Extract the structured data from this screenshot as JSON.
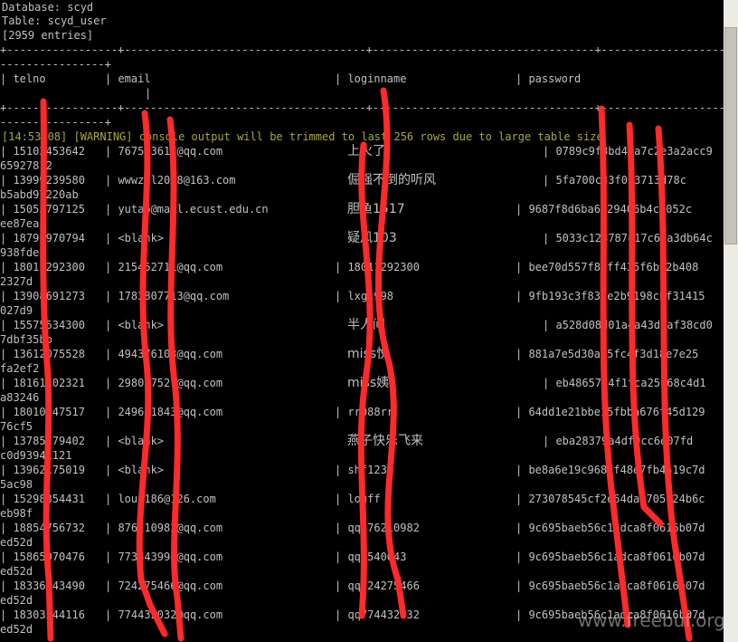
{
  "header": {
    "database": "Database: scyd",
    "table": "Table: scyd_user",
    "entries": "[2959 entries]"
  },
  "borders": {
    "top": "+-----------------+-------------------------------------+----------------------------------+-------------------------------------",
    "cont": "----------------+",
    "mid": "+-----------------+-------------------------------------+----------------------------------+-------------------------------------"
  },
  "columns": {
    "telno": "| telno",
    "email": "| email",
    "loginname": "| loginname",
    "password": "| password",
    "cont": "|"
  },
  "warning": "[14:53:08] [WARNING] console output will be trimmed to last 256 rows due to large table size",
  "rows": [
    {
      "telno": "| 15102453642",
      "email": "| 767523617@qq.com",
      "login": "上火了",
      "pass": "| 0789c9f8bd4da7c2e3a2acc9",
      "cont": "65927812"
    },
    {
      "telno": "| 13999239580",
      "email": "| wwwzhl2008@163.com",
      "login": "倔强不倒的听风",
      "pass": "| 5fa700c33f013713d78c",
      "cont": "b5abd97220ab"
    },
    {
      "telno": "| 15055797125",
      "email": "| yutao@mail.ecust.edu.cn",
      "login": "胆鱼1517",
      "pass": "| 9687f8d6ba6729406b4c1052c",
      "cont": "ee87ea"
    },
    {
      "telno": "| 18791970794",
      "email": "| <blank>",
      "login": "疑风103",
      "pass": "| 5033c128787c17c63a3db64c",
      "cont": "938fde"
    },
    {
      "telno": "| 18011292300",
      "email": "| 215452711@qq.com",
      "login": "| 18011292300",
      "pass": "| bee70d557f8bff435f6b92b408",
      "cont": "2327d"
    },
    {
      "telno": "| 13908691273",
      "email": "| 1783807713@qq.com",
      "login": "| lxg1998",
      "pass": "| 9fb193c3f83ce2b9198cbf31415",
      "cont": "027d9"
    },
    {
      "telno": "| 15575534300",
      "email": "| <blank>",
      "login": "半人间",
      "pass": "| a528d08d01a4a43d6af38cd0",
      "cont": "7dbf35bb"
    },
    {
      "telno": "| 13612075528",
      "email": "| 494376103@qq.com",
      "login": "miss悦",
      "pass": "| 881a7e5d30aa5fc4f3d18e7e25",
      "cont": "fa2ef2"
    },
    {
      "telno": "| 18161202321",
      "email": "| 298037527@qq.com",
      "login": "miss姨",
      "pass": "| eb4865714f1fca25c68c4d1",
      "cont": "a83246"
    },
    {
      "telno": "| 18010147517",
      "email": "| 249631843@qq.com",
      "login": "| rr088rr",
      "pass": "| 64dd1e21bbe15fbba676f45d129",
      "cont": "76cf5"
    },
    {
      "telno": "| 13785779402",
      "email": "| <blank>",
      "login": "燕子快乐飞来",
      "pass": "| eba28379a4df9cc6e07fd",
      "cont": "c0d93941121"
    },
    {
      "telno": "| 13962175019",
      "email": "| <blank>",
      "login": "| shf1234",
      "pass": "| be8a6e19c968ff48e7fb4519c7d",
      "cont": "5ac98"
    },
    {
      "telno": "| 15298354431",
      "email": "| louf186@126.com",
      "login": "| louff",
      "pass": "| 273078545cf2e54daf705724b6c",
      "cont": "eb98f"
    },
    {
      "telno": "| 18854756732",
      "email": "| 876210982@qq.com",
      "login": "| qq876210982",
      "pass": "| 9c695baeb56c1adca8f0616b07d",
      "cont": "ed52d"
    },
    {
      "telno": "| 15865070476",
      "email": "| 773843994@qq.com",
      "login": "| qq7540043",
      "pass": "| 9c695baeb56c1adca8f0616b07d",
      "cont": "ed52d"
    },
    {
      "telno": "| 18336143490",
      "email": "| 724275466@qq.com",
      "login": "| qq724275466",
      "pass": "| 9c695baeb56c1adca8f0616b07d",
      "cont": "ed52d"
    },
    {
      "telno": "| 18303544116",
      "email": "| 774432032@qq.com",
      "login": "| qq774432032",
      "pass": "| 9c695baeb56c1adca8f0616b07d",
      "cont": "ed52d"
    }
  ],
  "watermark": "www.freebuf.org"
}
